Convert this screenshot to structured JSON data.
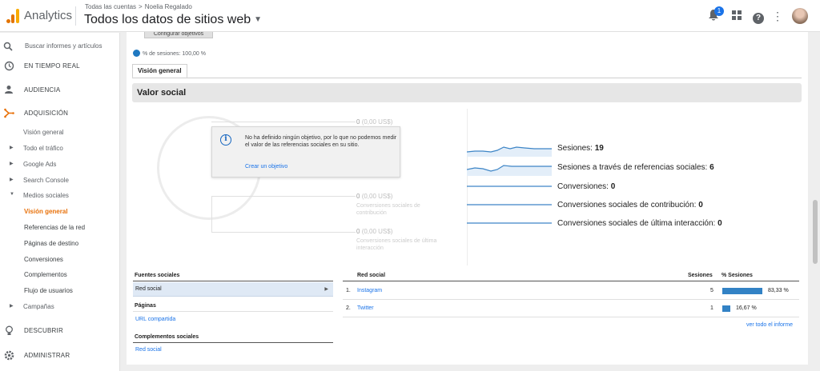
{
  "header": {
    "app_name": "Analytics",
    "breadcrumb": [
      "Todas las cuentas",
      "Noelia Regalado"
    ],
    "breadcrumb_sep": ">",
    "view_title": "Todos los datos de sitios web",
    "notification_count": "1"
  },
  "sidebar": {
    "search_placeholder": "Buscar informes y artículos",
    "main_items": [
      {
        "label": "EN TIEMPO REAL",
        "icon": "clock-icon"
      },
      {
        "label": "AUDIENCIA",
        "icon": "person-icon"
      },
      {
        "label": "ADQUISICIÓN",
        "icon": "acquisition-icon"
      },
      {
        "label": "DESCUBRIR",
        "icon": "lightbulb-icon"
      },
      {
        "label": "ADMINISTRAR",
        "icon": "gear-icon"
      }
    ],
    "sub_items": [
      "Visión general",
      "Todo el tráfico",
      "Google Ads",
      "Search Console",
      "Medios sociales",
      "Visión general",
      "Referencias de la red",
      "Páginas de destino",
      "Conversiones",
      "Complementos",
      "Flujo de usuarios",
      "Campañas"
    ]
  },
  "main": {
    "goals_button": "Configurar objetivos",
    "sessions_pct": "% de sesiones: 100,00 %",
    "tab": "Visión general",
    "section_title": "Valor social",
    "diagram": {
      "top_value": "0",
      "top_money": "(0,00 US$)",
      "mid_value": "0",
      "mid_money": "(0,00 US$)",
      "mid_label": "Conversiones sociales de contribución",
      "bot_value": "0",
      "bot_money": "(0,00 US$)",
      "bot_label": "Conversiones sociales de última interacción"
    },
    "info_box": {
      "message": "No ha definido ningún objetivo, por lo que no podemos medir el valor de las referencias sociales en su sitio.",
      "link": "Crear un objetivo"
    },
    "metrics": [
      {
        "label": "Sesiones:",
        "value": "19"
      },
      {
        "label": "Sesiones a través de referencias sociales:",
        "value": "6"
      },
      {
        "label": "Conversiones:",
        "value": "0"
      },
      {
        "label": "Conversiones sociales de contribución:",
        "value": "0"
      },
      {
        "label": "Conversiones sociales de última interacción:",
        "value": "0"
      }
    ],
    "sources": {
      "header": "Fuentes sociales",
      "selected": "Red social",
      "pages_header": "Páginas",
      "pages_link": "URL compartida",
      "plugins_header": "Complementos sociales",
      "plugins_link": "Red social"
    },
    "network_table": {
      "col_network": "Red social",
      "col_sessions": "Sesiones",
      "col_pct": "% Sesiones",
      "rows": [
        {
          "idx": "1.",
          "name": "Instagram",
          "sessions": "5",
          "pct": "83,33 %",
          "share": 0.8333
        },
        {
          "idx": "2.",
          "name": "Twitter",
          "sessions": "1",
          "pct": "16,67 %",
          "share": 0.1667
        }
      ],
      "full_report": "ver todo el informe"
    }
  },
  "colors": {
    "accent_orange": "#e8710a",
    "link_blue": "#1a73e8",
    "bar_blue": "#3282c5"
  }
}
